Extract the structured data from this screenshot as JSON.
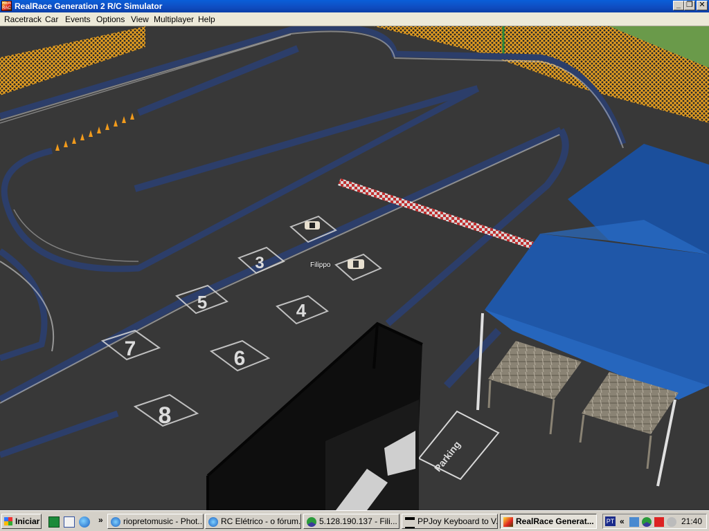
{
  "window": {
    "title": "RealRace Generation 2 R/C Simulator",
    "icon_text": "REAL RACE",
    "minimize": "_",
    "maximize": "❐",
    "close": "✕"
  },
  "menu": [
    "Racetrack",
    "Car",
    "Events",
    "Options",
    "View",
    "Multiplayer",
    "Help"
  ],
  "scene": {
    "driver_label": "Filippo",
    "grid_numbers": [
      "3",
      "4",
      "5",
      "6",
      "7",
      "8"
    ],
    "parking_label": "Parking",
    "colors": {
      "asphalt": "#3a3a3a",
      "curb": "#2c3e6a",
      "tent": "#1f57a8",
      "fence": "#e8a020",
      "grass": "#6a9a4a"
    }
  },
  "taskbar": {
    "start_label": "Iniciar",
    "quicklaunch_more": "»",
    "tasks": [
      {
        "label": "riopretomusic - Phot...",
        "icon": "browser-icon"
      },
      {
        "label": "RC Elétrico - o fórum...",
        "icon": "browser-icon"
      },
      {
        "label": "5.128.190.137 - Fili...",
        "icon": "network-icon"
      },
      {
        "label": "PPJoy Keyboard to V...",
        "icon": "joystick-icon"
      },
      {
        "label": "RealRace Generat...",
        "icon": "realrace-icon",
        "active": true
      }
    ],
    "language": "PT",
    "tray_more": "«",
    "clock": "21:40"
  }
}
